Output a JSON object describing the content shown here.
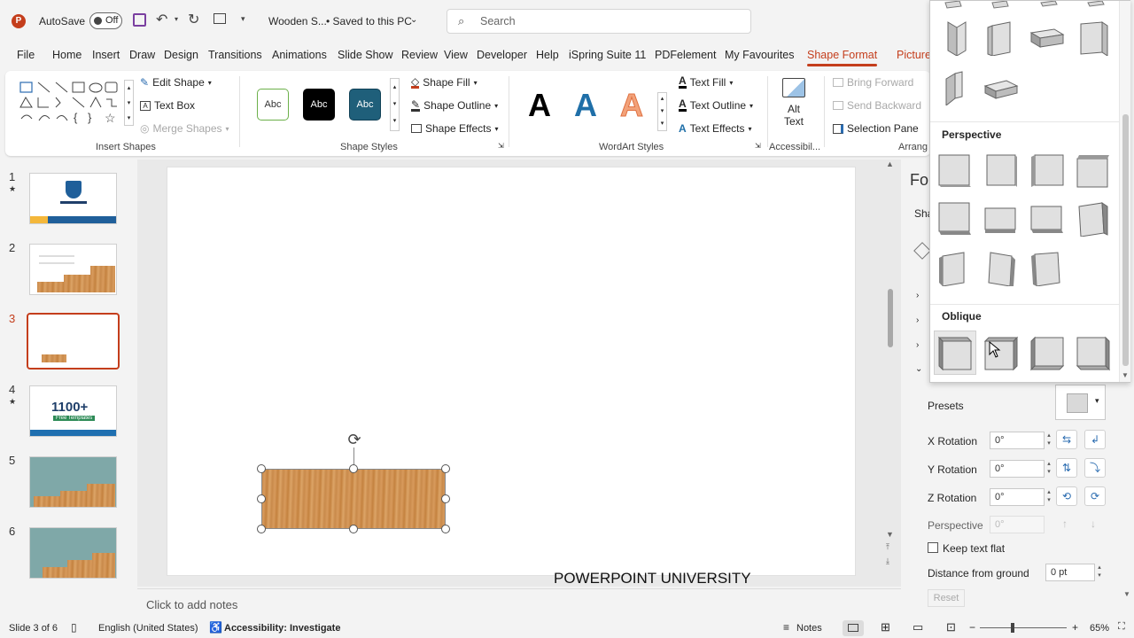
{
  "titlebar": {
    "autosave_label": "AutoSave",
    "autosave_state": "Off",
    "doc_title": "Wooden S...",
    "save_status": "• Saved to this PC",
    "search_placeholder": "Search"
  },
  "menu": [
    "File",
    "Home",
    "Insert",
    "Draw",
    "Design",
    "Transitions",
    "Animations",
    "Slide Show",
    "Review",
    "View",
    "Developer",
    "Help",
    "iSpring Suite 11",
    "PDFelement",
    "My Favourites",
    "Shape Format",
    "Picture"
  ],
  "ribbon": {
    "insert_shapes": {
      "edit_shape": "Edit Shape",
      "text_box": "Text Box",
      "merge_shapes": "Merge Shapes",
      "label": "Insert Shapes"
    },
    "shape_styles": {
      "swatch_text": "Abc",
      "shape_fill": "Shape Fill",
      "shape_outline": "Shape Outline",
      "shape_effects": "Shape Effects",
      "label": "Shape Styles"
    },
    "wordart": {
      "letter": "A",
      "text_fill": "Text Fill",
      "text_outline": "Text Outline",
      "text_effects": "Text Effects",
      "label": "WordArt Styles"
    },
    "accessibility": {
      "alt": "Alt",
      "text": "Text",
      "label": "Accessibil..."
    },
    "arrange": {
      "bring_forward": "Bring Forward",
      "send_backward": "Send Backward",
      "selection_pane": "Selection Pane",
      "label": "Arrang"
    }
  },
  "slides": [
    {
      "num": "1",
      "star": "★"
    },
    {
      "num": "2",
      "star": ""
    },
    {
      "num": "3",
      "star": ""
    },
    {
      "num": "4",
      "star": "★",
      "big_text": "1100+",
      "small_text": "Free Templates"
    },
    {
      "num": "5",
      "star": ""
    },
    {
      "num": "6",
      "star": ""
    }
  ],
  "slide": {
    "footer_text": "POWERPOINT UNIVERSITY"
  },
  "notes_placeholder": "Click to add notes",
  "format_pane": {
    "title_partial": "Fo",
    "tab_partial": "Sha",
    "presets_label": "Presets",
    "x_rotation_label": "X Rotation",
    "y_rotation_label": "Y Rotation",
    "z_rotation_label": "Z Rotation",
    "perspective_label": "Perspective",
    "x_value": "0°",
    "y_value": "0°",
    "z_value": "0°",
    "perspective_value": "0°",
    "keep_text_flat": "Keep text flat",
    "distance_label": "Distance from ground",
    "distance_value": "0 pt",
    "reset_label": "Reset"
  },
  "gallery": {
    "perspective_heading": "Perspective",
    "oblique_heading": "Oblique"
  },
  "status": {
    "slide_info": "Slide 3 of 6",
    "language": "English (United States)",
    "accessibility": "Accessibility: Investigate",
    "notes": "Notes",
    "zoom": "65%"
  },
  "colors": {
    "accent": "#c43e1c",
    "wood": "#d0904f"
  }
}
